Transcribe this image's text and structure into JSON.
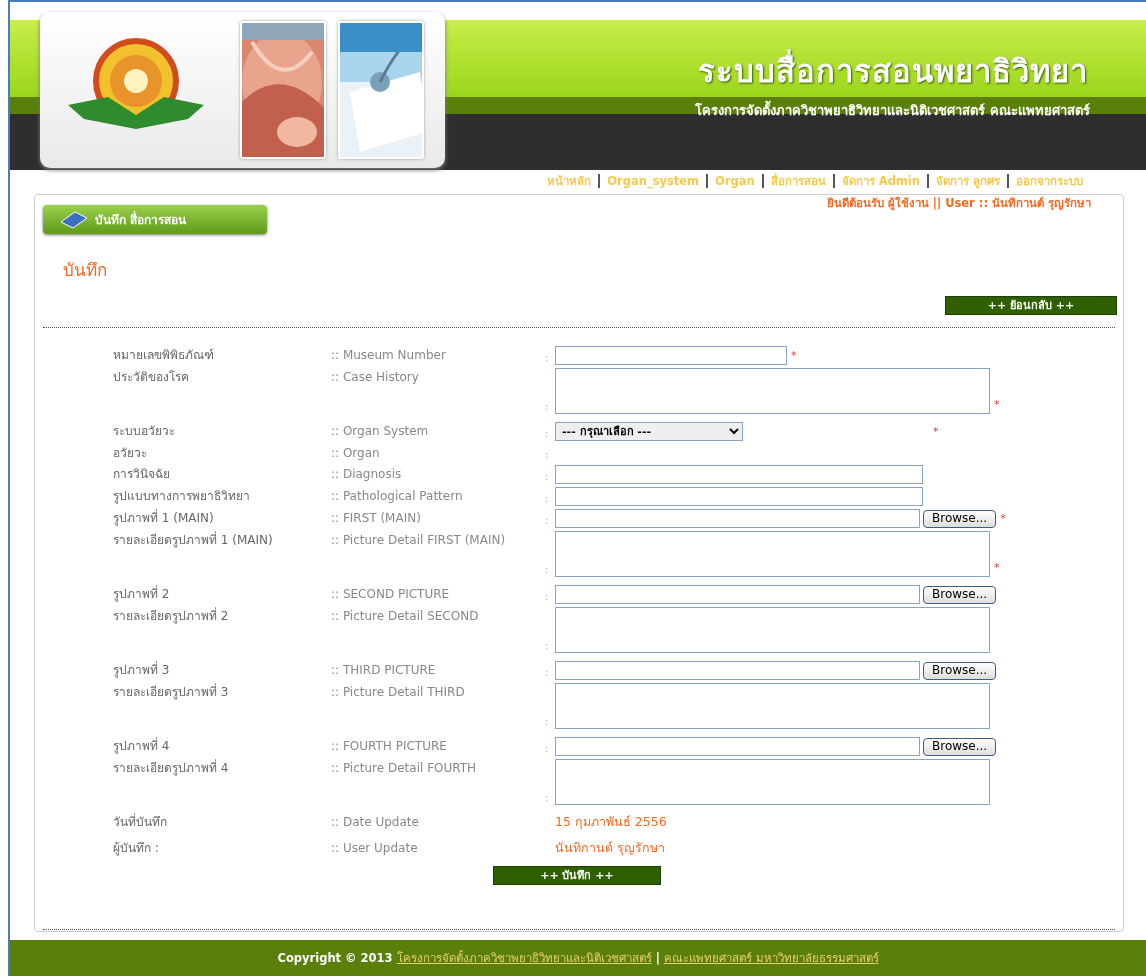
{
  "header": {
    "title": "ระบบสื่อการสอนพยาธิวิทยา",
    "subtitle": "โครงการจัดตั้งภาควิชาพยาธิวิทยาและนิติเวชศาสตร์ คณะแพทยศาสตร์"
  },
  "nav": [
    "หน้าหลัก",
    "Organ_system",
    "Organ",
    "สื่อการสอน",
    "จัดการ Admin",
    "จัดการ ลูกศร",
    "ออกจากระบบ"
  ],
  "welcome": "ยินดีต้อนรับ ผู้ใช้งาน || User :: นันทิกานต์ รุญรักษา",
  "section_tab": "บันทึก สื่อการสอน",
  "heading": "บันทึก",
  "back_button": "++ ย้อนกลับ ++",
  "fields": [
    {
      "kind": "text",
      "label_th": "หมายเลขพิพิธภัณฑ์",
      "label_en": ":: Museum Number",
      "separator": ":",
      "required_mark": "*"
    },
    {
      "kind": "textarea",
      "label_th": "ประวัติของโรค",
      "label_en": ":: Case History",
      "separator": ":",
      "required_mark": "*"
    },
    {
      "kind": "select",
      "label_th": "ระบบอวัยวะ",
      "label_en": ":: Organ System",
      "separator": ":",
      "required_mark": "*",
      "value": "--- กรุณาเลือก ---"
    },
    {
      "kind": "none",
      "label_th": "อวัยวะ",
      "label_en": ":: Organ",
      "separator": ":"
    },
    {
      "kind": "long_text",
      "label_th": "การวินิจฉัย",
      "label_en": ":: Diagnosis",
      "separator": ":"
    },
    {
      "kind": "long_text",
      "label_th": "รูปแบบทางการพยาธิวิทยา",
      "label_en": ":: Pathological Pattern",
      "separator": ":"
    },
    {
      "kind": "file",
      "label_th": "รูปภาพที่ 1 (MAIN)",
      "label_en": ":: FIRST (MAIN)",
      "separator": ":",
      "required_mark": "*",
      "button": "Browse..."
    },
    {
      "kind": "textarea",
      "label_th": "รายละเอียดรูปภาพที่ 1 (MAIN)",
      "label_en": ":: Picture Detail FIRST (MAIN)",
      "separator": ":",
      "required_mark": "*"
    },
    {
      "kind": "file",
      "label_th": "รูปภาพที่ 2",
      "label_en": ":: SECOND PICTURE",
      "separator": ":",
      "button": "Browse..."
    },
    {
      "kind": "textarea",
      "label_th": "รายละเอียดรูปภาพที่ 2",
      "label_en": ":: Picture Detail SECOND",
      "separator": ":"
    },
    {
      "kind": "file",
      "label_th": "รูปภาพที่ 3",
      "label_en": ":: THIRD PICTURE",
      "separator": ":",
      "button": "Browse..."
    },
    {
      "kind": "textarea",
      "label_th": "รายละเอียดรูปภาพที่ 3",
      "label_en": ":: Picture Detail THIRD",
      "separator": ":"
    },
    {
      "kind": "file",
      "label_th": "รูปภาพที่ 4",
      "label_en": ":: FOURTH PICTURE",
      "separator": ":",
      "button": "Browse..."
    },
    {
      "kind": "textarea",
      "label_th": "รายละเอียดรูปภาพที่ 4",
      "label_en": ":: Picture Detail FOURTH",
      "separator": ":"
    },
    {
      "kind": "value",
      "label_th": "วันที่บันทึก",
      "label_en": ":: Date Update",
      "value": "15 กุมภาพันธ์ 2556"
    },
    {
      "kind": "value",
      "label_th": "ผู้บันทึก :",
      "label_en": ":: User Update",
      "value": "นันทิกานต์ รุญรักษา"
    }
  ],
  "save_button": "++ บันทึก ++",
  "footer": {
    "copyright": "Copyright © 2013",
    "links": [
      "โครงการจัดตั้งภาควิชาพยาธิวิทยาและนิติเวชศาสตร์",
      "คณะแพทยศาสตร์ มหาวิทยาลัยธรรมศาสตร์"
    ],
    "divider": "|"
  }
}
